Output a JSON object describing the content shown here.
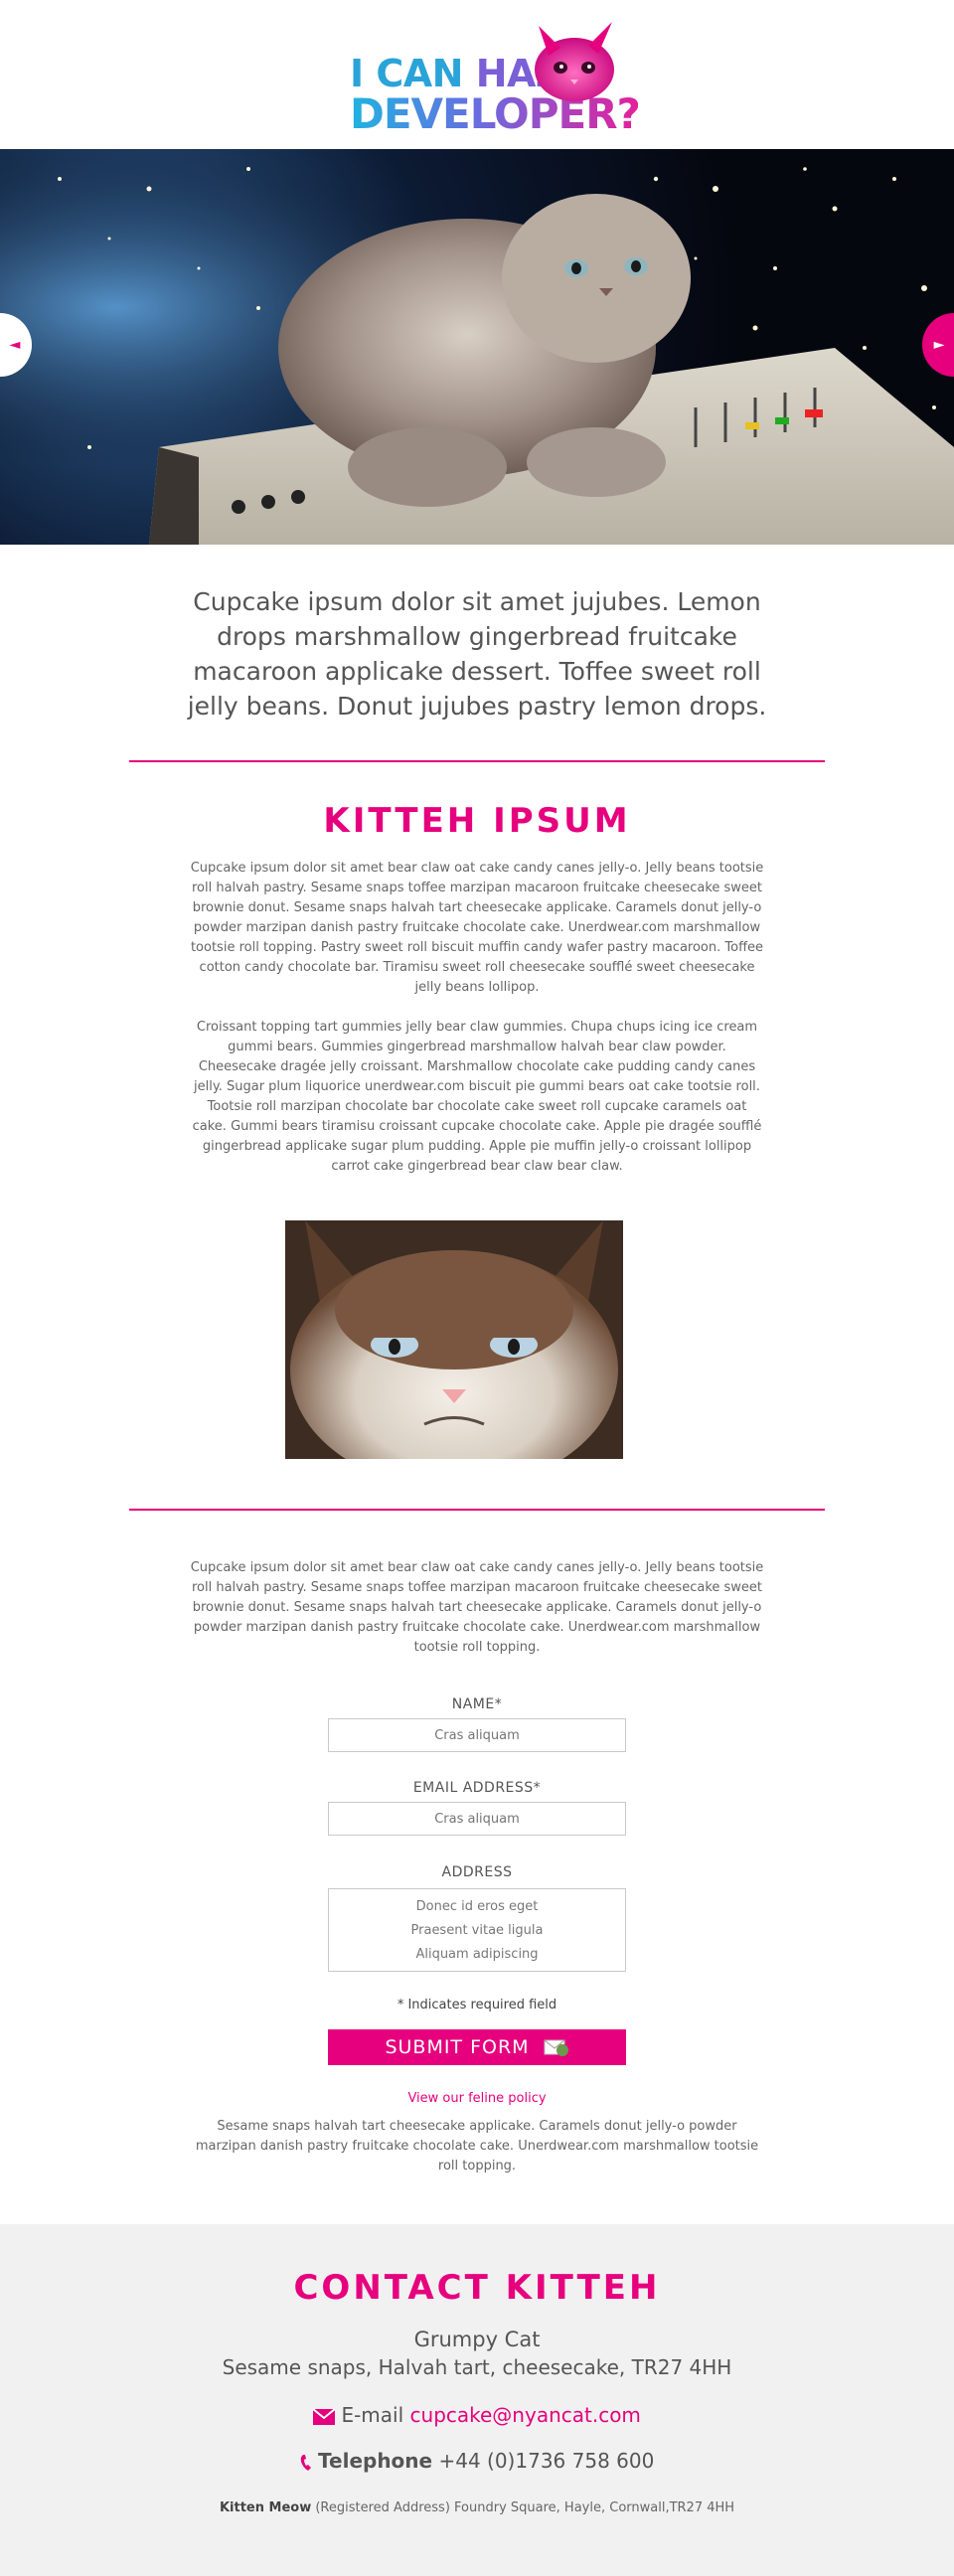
{
  "logo": {
    "line1_prefix": "I CAN",
    "line1_suffix": "HAZ",
    "line2": "DEVELOPER?"
  },
  "hero": {
    "prev_arrow": "◄",
    "next_arrow": "►"
  },
  "intro": "Cupcake ipsum dolor sit amet jujubes. Lemon drops marshmallow gingerbread fruitcake macaroon applicake dessert. Toffee sweet roll jelly beans. Donut jujubes pastry lemon drops.",
  "kitteh": {
    "title": "KITTEH IPSUM",
    "para1": "Cupcake ipsum dolor sit amet bear claw oat cake candy canes jelly-o. Jelly beans tootsie roll halvah pastry. Sesame snaps toffee marzipan macaroon fruitcake cheesecake sweet brownie donut. Sesame snaps halvah tart cheesecake applicake. Caramels donut jelly-o powder marzipan danish pastry fruitcake chocolate cake. Unerdwear.com marshmallow tootsie roll topping. Pastry sweet roll biscuit muffin candy wafer pastry macaroon. Toffee cotton candy chocolate bar. Tiramisu sweet roll cheesecake soufflé sweet cheesecake jelly beans lollipop.",
    "para2": "Croissant topping tart gummies jelly bear claw gummies. Chupa chups icing ice cream gummi bears. Gummies gingerbread marshmallow halvah bear claw powder. Cheesecake dragée jelly croissant. Marshmallow chocolate cake pudding candy canes jelly. Sugar plum liquorice unerdwear.com biscuit pie gummi bears oat cake tootsie roll. Tootsie roll marzipan chocolate bar chocolate cake sweet roll cupcake caramels oat cake. Gummi bears tiramisu croissant cupcake chocolate cake. Apple pie dragée soufflé gingerbread applicake sugar plum pudding. Apple pie muffin jelly-o croissant lollipop carrot cake gingerbread bear claw bear claw."
  },
  "form_intro": "Cupcake ipsum dolor sit amet bear claw oat cake candy canes jelly-o. Jelly beans tootsie roll halvah pastry. Sesame snaps toffee marzipan macaroon fruitcake cheesecake sweet brownie donut. Sesame snaps halvah tart cheesecake applicake. Caramels donut jelly-o powder marzipan danish pastry fruitcake chocolate cake. Unerdwear.com marshmallow tootsie roll topping.",
  "form": {
    "name_label": "NAME*",
    "name_placeholder": "Cras aliquam",
    "email_label": "EMAIL ADDRESS*",
    "email_placeholder": "Cras aliquam",
    "address_label": "ADDRESS",
    "address_value": "Donec id eros eget\nPraesent vitae ligula\nAliquam adipiscing",
    "required_note": "* Indicates required field",
    "submit_label": "SUBMIT FORM",
    "policy_link": "View our feline policy",
    "policy_text": "Sesame snaps halvah tart cheesecake applicake. Caramels donut jelly-o powder marzipan danish pastry fruitcake chocolate cake. Unerdwear.com marshmallow tootsie roll topping."
  },
  "footer": {
    "title": "CONTACT KITTEH",
    "name": "Grumpy Cat",
    "address": "Sesame snaps, Halvah tart, cheesecake, TR27 4HH",
    "email_label": "E-mail",
    "email": "cupcake@nyancat.com",
    "phone_label": "Telephone",
    "phone": "+44 (0)1736 758 600",
    "reg_name": "Kitten Meow",
    "reg_address": "(Registered Address) Foundry Square, Hayle, Cornwall,TR27 4HH"
  },
  "colors": {
    "accent": "#e6007e",
    "footer_bg": "#f1f1f1",
    "text": "#555555"
  },
  "icons": [
    "cat-head-icon",
    "prev-arrow-icon",
    "next-arrow-icon",
    "cat-envelope-icon",
    "envelope-icon",
    "phone-icon",
    "hand-cursor-icon"
  ]
}
